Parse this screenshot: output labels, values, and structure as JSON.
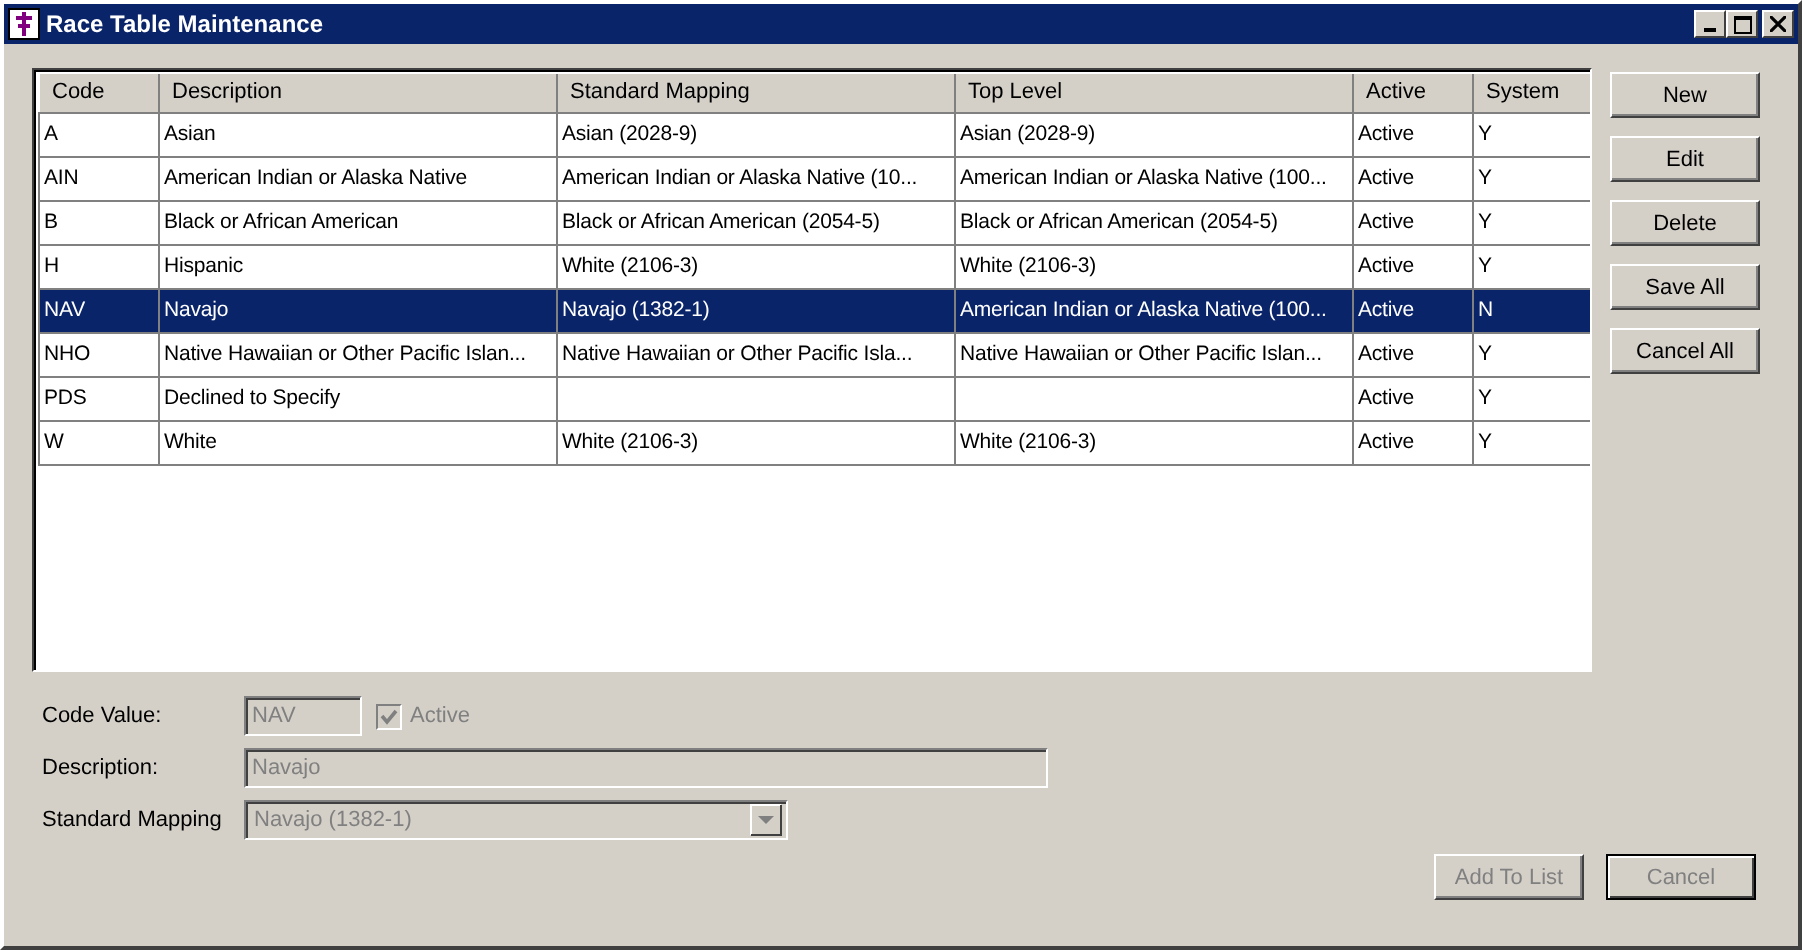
{
  "window": {
    "title": "Race Table Maintenance"
  },
  "table": {
    "columns": [
      "Code",
      "Description",
      "Standard Mapping",
      "Top Level",
      "Active",
      "System"
    ],
    "rows": [
      {
        "cells": [
          "A",
          "Asian",
          "Asian  (2028-9)",
          "Asian (2028-9)",
          "Active",
          "Y"
        ],
        "selected": false
      },
      {
        "cells": [
          "AIN",
          "American Indian or Alaska Native",
          "American Indian or Alaska Native  (10...",
          "American Indian or Alaska Native (100...",
          "Active",
          "Y"
        ],
        "selected": false
      },
      {
        "cells": [
          "B",
          "Black or African American",
          "Black or African American  (2054-5)",
          "Black or African American (2054-5)",
          "Active",
          "Y"
        ],
        "selected": false
      },
      {
        "cells": [
          "H",
          "Hispanic",
          "White  (2106-3)",
          "White (2106-3)",
          "Active",
          "Y"
        ],
        "selected": false
      },
      {
        "cells": [
          "NAV",
          "Navajo",
          "Navajo  (1382-1)",
          "American Indian or Alaska Native (100...",
          "Active",
          "N"
        ],
        "selected": true
      },
      {
        "cells": [
          "NHO",
          "Native Hawaiian or Other Pacific Islan...",
          "Native Hawaiian or Other Pacific Isla...",
          "Native Hawaiian or Other Pacific Islan...",
          "Active",
          "Y"
        ],
        "selected": false
      },
      {
        "cells": [
          "PDS",
          "Declined to Specify",
          "",
          "",
          "Active",
          "Y"
        ],
        "selected": false
      },
      {
        "cells": [
          "W",
          "White",
          "White  (2106-3)",
          "White (2106-3)",
          "Active",
          "Y"
        ],
        "selected": false
      }
    ]
  },
  "side_buttons": [
    {
      "label": "New"
    },
    {
      "label": "Edit"
    },
    {
      "label": "Delete"
    },
    {
      "label": "Save All"
    },
    {
      "label": "Cancel All"
    }
  ],
  "form": {
    "code_value": {
      "label": "Code Value:",
      "value": "NAV",
      "disabled": true
    },
    "active": {
      "label": "Active",
      "checked": true,
      "disabled": true
    },
    "description": {
      "label": "Description:",
      "value": "Navajo",
      "disabled": true
    },
    "standard_mapping": {
      "label": "Standard Mapping",
      "value": "Navajo  (1382-1)",
      "disabled": true
    }
  },
  "bottom_buttons": [
    {
      "label": "Add To List",
      "disabled": true,
      "default": false
    },
    {
      "label": "Cancel",
      "disabled": true,
      "default": true
    }
  ]
}
